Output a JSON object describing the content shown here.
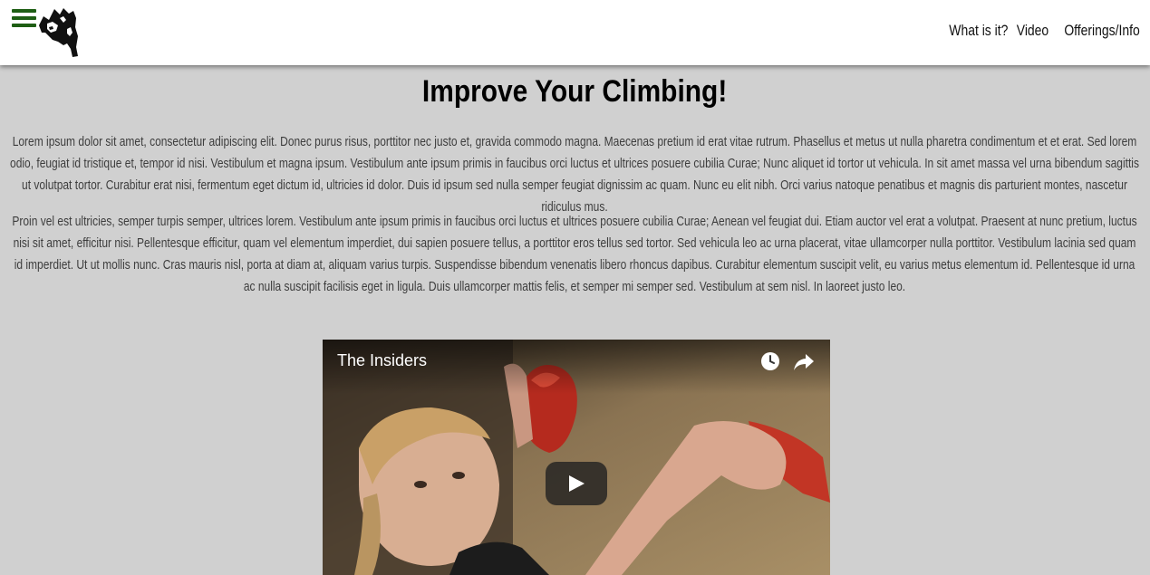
{
  "header": {
    "menu_icon": "hamburger-menu-icon",
    "logo_icon": "climber-silhouette-logo",
    "accent_color": "#1e5e14",
    "nav": [
      {
        "label": "What is it?"
      },
      {
        "label": "Video"
      },
      {
        "label": "Offerings/Info"
      }
    ]
  },
  "main": {
    "title": "Improve Your Climbing!",
    "paragraphs": [
      "Lorem ipsum dolor sit amet, consectetur adipiscing elit. Donec purus risus, porttitor nec justo et, gravida commodo magna. Maecenas pretium id erat vitae rutrum. Phasellus et metus ut nulla pharetra condimentum et et erat. Sed lorem odio, feugiat id tristique et, tempor id nisi. Vestibulum et magna ipsum. Vestibulum ante ipsum primis in faucibus orci luctus et ultrices posuere cubilia Curae; Nunc aliquet id tortor ut vehicula. In sit amet massa vel urna bibendum sagittis ut volutpat tortor. Curabitur erat nisi, fermentum eget dictum id, ultricies id dolor. Duis id ipsum sed nulla semper feugiat dignissim ac quam. Nunc eu elit nibh. Orci varius natoque penatibus et magnis dis parturient montes, nascetur ridiculus mus.",
      "Proin vel est ultricies, semper turpis semper, ultrices lorem. Vestibulum ante ipsum primis in faucibus orci luctus et ultrices posuere cubilia Curae; Aenean vel feugiat dui. Etiam auctor vel erat a volutpat. Praesent at nunc pretium, luctus nisi sit amet, efficitur nisi. Pellentesque efficitur, quam vel elementum imperdiet, dui sapien posuere tellus, a porttitor eros tellus sed tortor. Sed vehicula leo ac urna placerat, vitae ullamcorper nulla porttitor. Vestibulum lacinia sed quam id imperdiet. Ut ut mollis nunc. Cras mauris nisl, porta at diam at, aliquam varius turpis. Suspendisse bibendum venenatis libero rhoncus dapibus. Curabitur elementum suscipit velit, eu varius metus elementum id. Pellentesque id urna ac nulla suscipit facilisis eget in ligula. Duis ullamcorper mattis felis, et semper mi semper sed. Vestibulum at sem nisl. In laoreet justo leo."
    ]
  },
  "video": {
    "title": "The Insiders",
    "watch_later_icon": "clock-icon",
    "share_icon": "share-arrow-icon",
    "play_icon": "play-icon"
  }
}
